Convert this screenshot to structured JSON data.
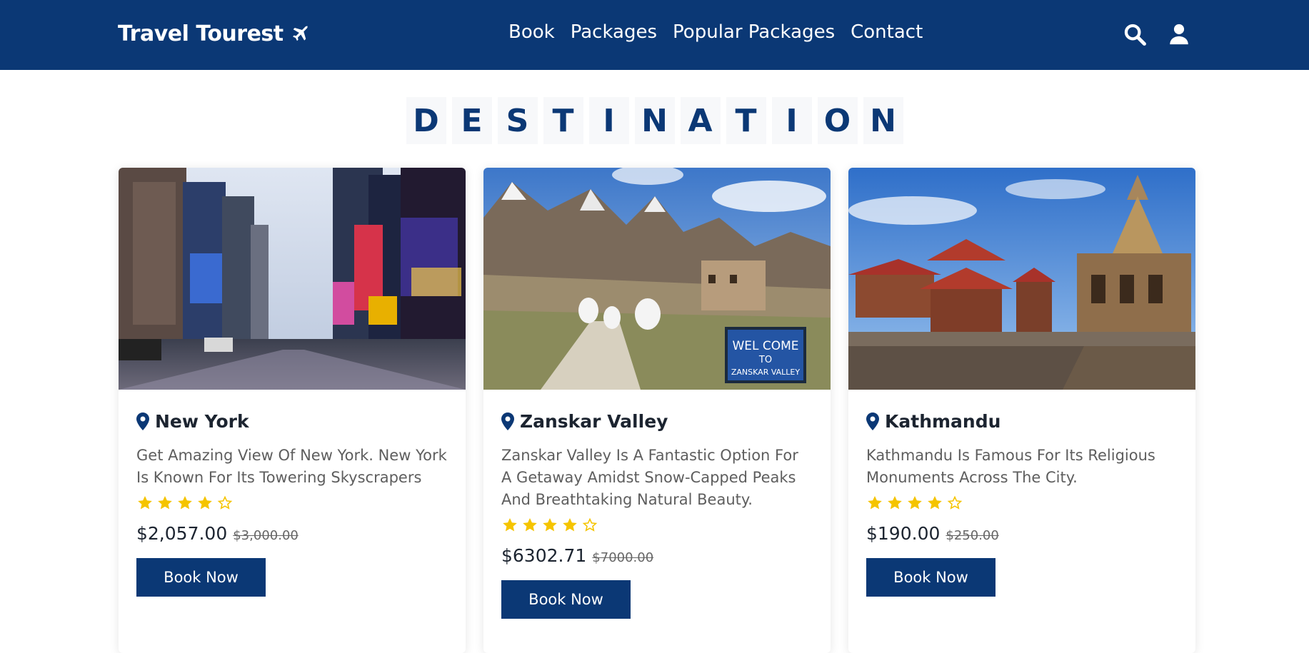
{
  "brand": {
    "name": "Travel Tourest",
    "icon": "airplane-icon"
  },
  "nav": {
    "links": [
      "Book",
      "Packages",
      "Popular Packages",
      "Contact"
    ],
    "icons": [
      "search-icon",
      "user-icon"
    ]
  },
  "section": {
    "title_letters": [
      "D",
      "E",
      "S",
      "T",
      "I",
      "N",
      "A",
      "T",
      "I",
      "O",
      "N"
    ]
  },
  "cards": [
    {
      "name": "New York",
      "description": "Get Amazing View Of New York. New York Is Known For Its Towering Skyscrapers",
      "rating": 4,
      "max_rating": 5,
      "price": "$2,057.00",
      "old_price": "$3,000.00",
      "button": "Book Now",
      "image": "new-york-times-square-photo"
    },
    {
      "name": "Zanskar Valley",
      "description": "Zanskar Valley Is A Fantastic Option For A Getaway Amidst Snow-Capped Peaks And Breathtaking Natural Beauty.",
      "rating": 4,
      "max_rating": 5,
      "price": "$6302.71",
      "old_price": "$7000.00",
      "button": "Book Now",
      "image": "zanskar-valley-mountains-photo",
      "image_sign_text": [
        "WEL COME",
        "TO",
        "ZANSKAR VALLEY"
      ]
    },
    {
      "name": "Kathmandu",
      "description": "Kathmandu Is Famous For Its Religious Monuments Across The City.",
      "rating": 4,
      "max_rating": 5,
      "price": "$190.00",
      "old_price": "$250.00",
      "button": "Book Now",
      "image": "kathmandu-temples-photo"
    }
  ],
  "colors": {
    "primary": "#0b3875",
    "star": "#f5c400",
    "heading_tile": "#f7f8fa"
  }
}
